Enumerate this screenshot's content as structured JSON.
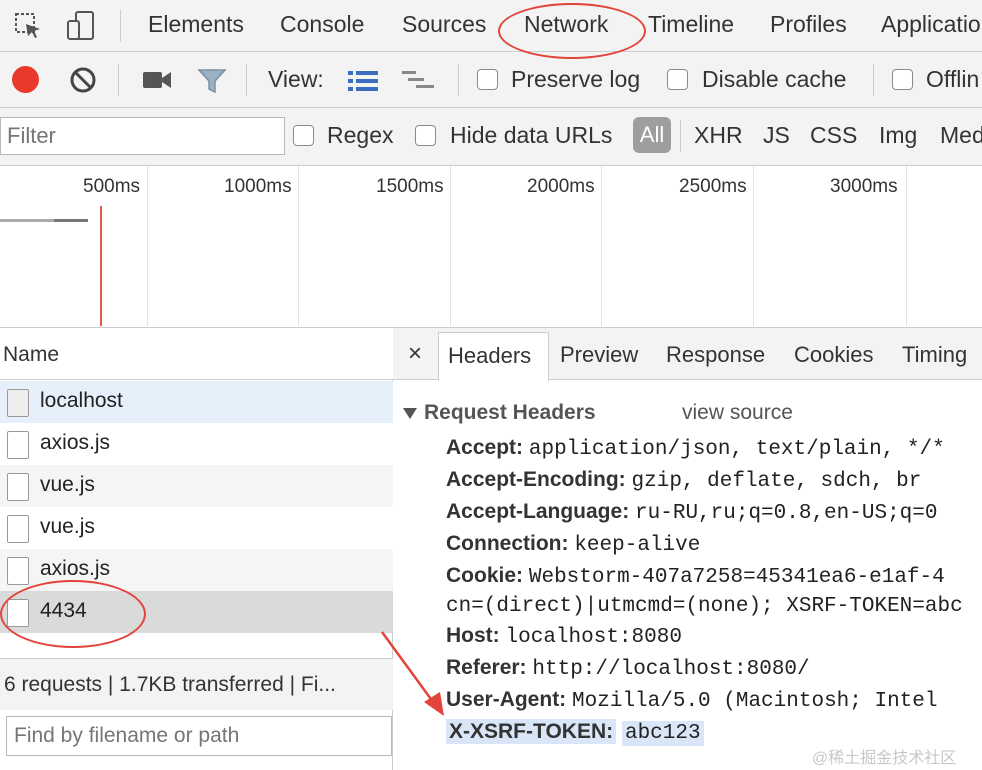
{
  "devtools_tabs": [
    "Elements",
    "Console",
    "Sources",
    "Network",
    "Timeline",
    "Profiles",
    "Applicatio"
  ],
  "toolbar": {
    "view_label": "View:",
    "preserve_log": "Preserve log",
    "disable_cache": "Disable cache",
    "offline": "Offlin"
  },
  "filter_bar": {
    "filter_placeholder": "Filter",
    "regex": "Regex",
    "hide_data_urls": "Hide data URLs",
    "all": "All",
    "types": [
      "XHR",
      "JS",
      "CSS",
      "Img",
      "Med"
    ]
  },
  "timeline": {
    "ticks": [
      "500ms",
      "1000ms",
      "1500ms",
      "2000ms",
      "2500ms",
      "3000ms"
    ]
  },
  "requests": {
    "column_header": "Name",
    "items": [
      "localhost",
      "axios.js",
      "vue.js",
      "vue.js",
      "axios.js",
      "4434"
    ],
    "summary": "6 requests | 1.7KB transferred | Fi...",
    "find_placeholder": "Find by filename or path"
  },
  "details": {
    "close": "×",
    "tabs": [
      "Headers",
      "Preview",
      "Response",
      "Cookies",
      "Timing"
    ],
    "section_title": "Request Headers",
    "view_source": "view source",
    "headers": [
      {
        "key": "Accept:",
        "value": "application/json, text/plain, */*"
      },
      {
        "key": "Accept-Encoding:",
        "value": "gzip, deflate, sdch, br"
      },
      {
        "key": "Accept-Language:",
        "value": "ru-RU,ru;q=0.8,en-US;q=0"
      },
      {
        "key": "Connection:",
        "value": "keep-alive"
      },
      {
        "key": "Cookie:",
        "value": "Webstorm-407a7258=45341ea6-e1af-4"
      },
      {
        "key": "",
        "value": "cn=(direct)|utmcmd=(none); XSRF-TOKEN=abc"
      },
      {
        "key": "Host:",
        "value": "localhost:8080"
      },
      {
        "key": "Referer:",
        "value": "http://localhost:8080/"
      },
      {
        "key": "User-Agent:",
        "value": "Mozilla/5.0 (Macintosh; Intel"
      },
      {
        "key": "X-XSRF-TOKEN:",
        "value": "abc123"
      }
    ]
  },
  "watermark": "@稀土掘金技术社区",
  "colors": {
    "record": "#e8392b",
    "annotation": "#e2443b",
    "selected_row": "#dadada",
    "highlight": "#d9e6f7"
  }
}
